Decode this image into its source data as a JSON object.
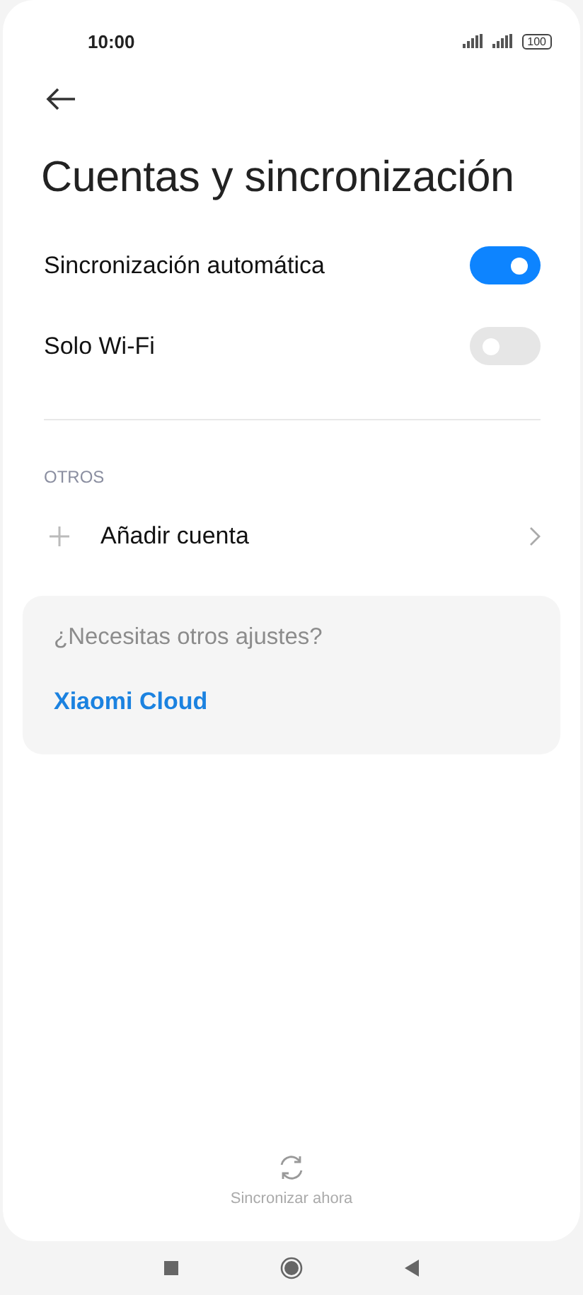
{
  "status_bar": {
    "time": "10:00",
    "battery": "100"
  },
  "title": "Cuentas y sincronización",
  "settings": [
    {
      "label": "Sincronización automática",
      "on": true
    },
    {
      "label": "Solo Wi-Fi",
      "on": false
    }
  ],
  "section_header": "OTROS",
  "add_account": {
    "label": "Añadir cuenta"
  },
  "help_card": {
    "question": "¿Necesitas otros ajustes?",
    "link": "Xiaomi Cloud"
  },
  "sync_now": {
    "label": "Sincronizar ahora"
  }
}
